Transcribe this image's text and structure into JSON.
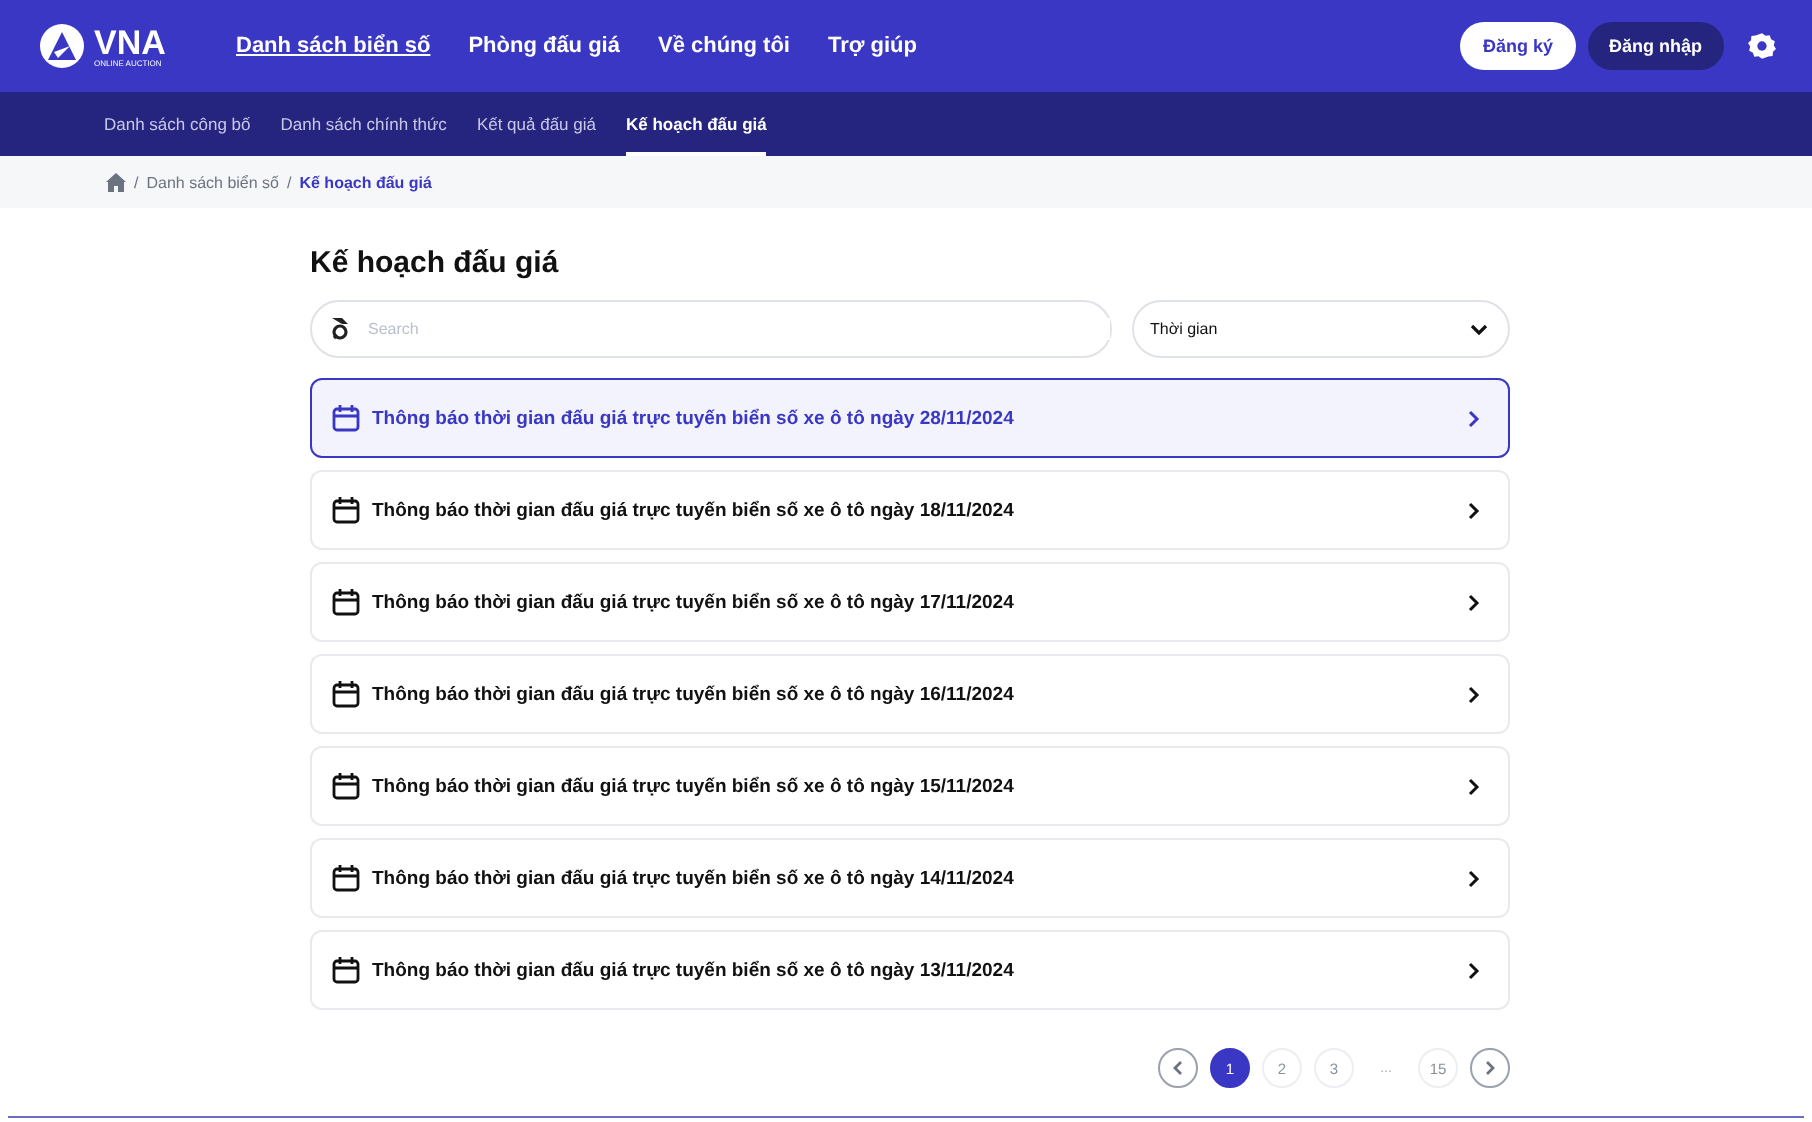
{
  "header": {
    "logo": {
      "name": "VNA",
      "tagline": "ONLINE AUCTION"
    },
    "nav": [
      {
        "label": "Danh sách biển số",
        "selected": true
      },
      {
        "label": "Phòng đấu giá",
        "selected": false
      },
      {
        "label": "Về chúng tôi",
        "selected": false
      },
      {
        "label": "Trợ giúp",
        "selected": false
      }
    ],
    "register": "Đăng ký",
    "login": "Đăng nhập"
  },
  "subnav": [
    {
      "label": "Danh sách công bố",
      "selected": false
    },
    {
      "label": "Danh sách chính thức",
      "selected": false
    },
    {
      "label": "Kết quả đấu giá",
      "selected": false
    },
    {
      "label": "Kế hoạch đấu giá",
      "selected": true
    }
  ],
  "breadcrumb": [
    {
      "separator": "/",
      "label": "Danh sách biển số"
    },
    {
      "separator": "/",
      "label": "Kế hoạch đấu giá"
    }
  ],
  "title": "Kế hoạch đấu giá",
  "search": {
    "placeholder": "Search"
  },
  "filter": {
    "value": "Thời gian"
  },
  "items": [
    {
      "title": "Thông báo thời gian đấu giá trực tuyến biển số xe ô tô ngày 28/11/2024",
      "selected": true
    },
    {
      "title": "Thông báo thời gian đấu giá trực tuyến biển số xe ô tô ngày 18/11/2024",
      "selected": false
    },
    {
      "title": "Thông báo thời gian đấu giá trực tuyến biển số xe ô tô ngày 17/11/2024",
      "selected": false
    },
    {
      "title": "Thông báo thời gian đấu giá trực tuyến biển số xe ô tô ngày 16/11/2024",
      "selected": false
    },
    {
      "title": "Thông báo thời gian đấu giá trực tuyến biển số xe ô tô ngày 15/11/2024",
      "selected": false
    },
    {
      "title": "Thông báo thời gian đấu giá trực tuyến biển số xe ô tô ngày 14/11/2024",
      "selected": false
    },
    {
      "title": "Thông báo thời gian đấu giá trực tuyến biển số xe ô tô ngày 13/11/2024",
      "selected": false
    }
  ],
  "pagination": [
    {
      "kind": "page",
      "label": "1",
      "selected": true
    },
    {
      "kind": "page",
      "label": "2",
      "selected": false
    },
    {
      "kind": "page",
      "label": "3",
      "selected": false
    },
    {
      "kind": "ellipsis",
      "label": "..."
    },
    {
      "kind": "page",
      "label": "15",
      "selected": false
    }
  ]
}
